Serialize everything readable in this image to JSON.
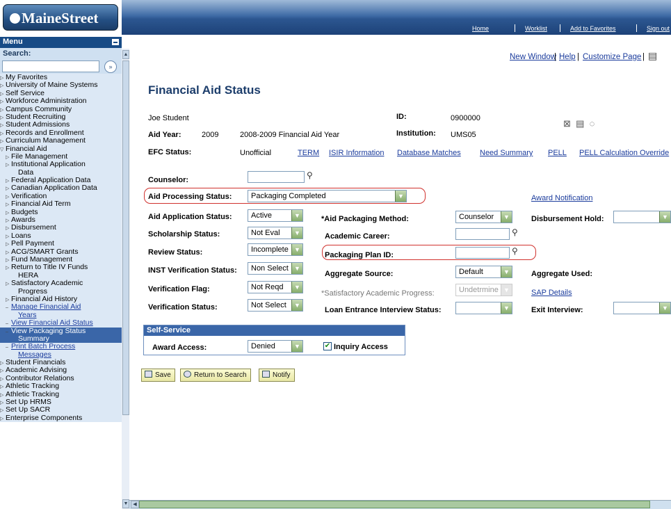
{
  "brand": {
    "logo_text": "MaineStreet"
  },
  "topnav": {
    "home": "Home",
    "worklist": "Worklist",
    "favorites": "Add to Favorites",
    "signout": "Sign out"
  },
  "menu": {
    "title": "Menu",
    "search_label": "Search:",
    "items": [
      {
        "label": "My Favorites",
        "level": 1,
        "tri": "▷"
      },
      {
        "label": "University of Maine Systems",
        "level": 1,
        "tri": "▷"
      },
      {
        "label": "Self Service",
        "level": 1,
        "tri": "▷"
      },
      {
        "label": "Workforce Administration",
        "level": 1,
        "tri": "▷"
      },
      {
        "label": "Campus Community",
        "level": 1,
        "tri": "▷"
      },
      {
        "label": "Student Recruiting",
        "level": 1,
        "tri": "▷"
      },
      {
        "label": "Student Admissions",
        "level": 1,
        "tri": "▷"
      },
      {
        "label": "Records and Enrollment",
        "level": 1,
        "tri": "▷"
      },
      {
        "label": "Curriculum Management",
        "level": 1,
        "tri": "▷"
      },
      {
        "label": "Financial Aid",
        "level": 1,
        "tri": "▽"
      },
      {
        "label": "File Management",
        "level": 2,
        "tri": "▷"
      },
      {
        "label": "Institutional Application",
        "level": 2,
        "tri": "▷"
      },
      {
        "label": "Data",
        "level": 3,
        "tri": ""
      },
      {
        "label": "Federal Application Data",
        "level": 2,
        "tri": "▷"
      },
      {
        "label": "Canadian Application Data",
        "level": 2,
        "tri": "▷"
      },
      {
        "label": "Verification",
        "level": 2,
        "tri": "▷"
      },
      {
        "label": "Financial Aid Term",
        "level": 2,
        "tri": "▷"
      },
      {
        "label": "Budgets",
        "level": 2,
        "tri": "▷"
      },
      {
        "label": "Awards",
        "level": 2,
        "tri": "▷"
      },
      {
        "label": "Disbursement",
        "level": 2,
        "tri": "▷"
      },
      {
        "label": "Loans",
        "level": 2,
        "tri": "▷"
      },
      {
        "label": "Pell Payment",
        "level": 2,
        "tri": "▷"
      },
      {
        "label": "ACG/SMART Grants",
        "level": 2,
        "tri": "▷"
      },
      {
        "label": "Fund Management",
        "level": 2,
        "tri": "▷"
      },
      {
        "label": "Return to Title IV Funds",
        "level": 2,
        "tri": "▷"
      },
      {
        "label": "HERA",
        "level": 3,
        "tri": ""
      },
      {
        "label": "Satisfactory Academic",
        "level": 2,
        "tri": "▷"
      },
      {
        "label": "Progress",
        "level": 3,
        "tri": ""
      },
      {
        "label": "Financial Aid History",
        "level": 2,
        "tri": "▷"
      },
      {
        "label": "Manage Financial Aid",
        "level": 2,
        "tri": "–",
        "link": true
      },
      {
        "label": "Years",
        "level": 3,
        "tri": "",
        "link": true
      },
      {
        "label": "View Financial Aid Status",
        "level": 2,
        "tri": "–",
        "link": true
      },
      {
        "label": "View Packaging Status",
        "level": 2,
        "tri": "–",
        "selected": true
      },
      {
        "label": "Summary",
        "level": 3,
        "tri": "",
        "selected": true
      },
      {
        "label": "Print Batch Process",
        "level": 2,
        "tri": "–",
        "link": true
      },
      {
        "label": "Messages",
        "level": 3,
        "tri": "",
        "link": true
      },
      {
        "label": "Student Financials",
        "level": 1,
        "tri": "▷"
      },
      {
        "label": "Academic Advising",
        "level": 1,
        "tri": "▷"
      },
      {
        "label": "Contributor Relations",
        "level": 1,
        "tri": "▷"
      },
      {
        "label": "Athletic Tracking",
        "level": 1,
        "tri": "▷"
      },
      {
        "label": "Athletic Tracking",
        "level": 1,
        "tri": "▷"
      },
      {
        "label": "Set Up HRMS",
        "level": 1,
        "tri": "▷"
      },
      {
        "label": "Set Up SACR",
        "level": 1,
        "tri": "▷"
      },
      {
        "label": "Enterprise Components",
        "level": 1,
        "tri": "▷"
      }
    ]
  },
  "header_links": {
    "new_window": "New Window",
    "help": "Help",
    "customize": "Customize Page"
  },
  "page": {
    "title": "Financial Aid Status",
    "student_name": "Joe Student",
    "id_label": "ID:",
    "id_value": "0900000",
    "aid_year_label": "Aid Year:",
    "aid_year_value": "2009",
    "aid_year_desc": "2008-2009 Financial Aid Year",
    "institution_label": "Institution:",
    "institution_value": "UMS05",
    "efc_label": "EFC Status:",
    "efc_value": "Unofficial",
    "efc_links": [
      "TERM",
      "ISIR Information",
      "Database Matches",
      "Need Summary",
      "PELL",
      "PELL Calculation Override"
    ]
  },
  "fields": {
    "counselor": "Counselor:",
    "aid_processing_status": {
      "label": "Aid Processing Status:",
      "value": "Packaging Completed"
    },
    "award_notification": "Award Notification",
    "aid_application_status": {
      "label": "Aid Application Status:",
      "value": "Active"
    },
    "aid_packaging_method": {
      "label": "*Aid Packaging Method:",
      "value": "Counselor"
    },
    "disbursement_hold": "Disbursement Hold:",
    "scholarship_status": {
      "label": "Scholarship Status:",
      "value": "Not Eval"
    },
    "academic_career": "Academic Career:",
    "review_status": {
      "label": "Review Status:",
      "value": "Incomplete"
    },
    "packaging_plan_id": "Packaging Plan ID:",
    "inst_verification_status": {
      "label": "INST Verification Status:",
      "value": "Non Select"
    },
    "aggregate_source": {
      "label": "Aggregate Source:",
      "value": "Default"
    },
    "aggregate_used": "Aggregate Used:",
    "verification_flag": {
      "label": "Verification Flag:",
      "value": "Not Reqd"
    },
    "satisfactory_progress": {
      "label": "*Satisfactory Academic Progress:",
      "value": "Undetrmine"
    },
    "sap_details": "SAP Details",
    "verification_status": {
      "label": "Verification Status:",
      "value": "Not Select"
    },
    "loan_entrance": "Loan Entrance Interview Status:",
    "exit_interview": "Exit Interview:"
  },
  "self_service": {
    "title": "Self-Service",
    "award_access_label": "Award Access:",
    "award_access_value": "Denied",
    "inquiry_access": "Inquiry Access"
  },
  "buttons": {
    "save": "Save",
    "return": "Return to Search",
    "notify": "Notify"
  }
}
